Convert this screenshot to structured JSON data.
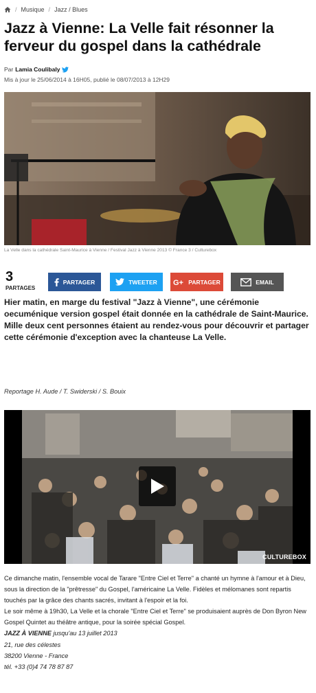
{
  "breadcrumb": {
    "home_icon": "home-icon",
    "items": [
      "Musique",
      "Jazz / Blues"
    ]
  },
  "article": {
    "title": "Jazz à Vienne: La Velle fait résonner la ferveur du gospel dans la cathédrale",
    "by_label": "Par",
    "author": "Lamia Coulibaly",
    "author_icon": "twitter-icon",
    "dates": "Mis à jour le 25/06/2014 à 16H05, publié le 08/07/2013 à 12H29",
    "image_caption": "La Velle dans la cathédrale Saint-Maurice à Vienne / Festival Jazz à Vienne 2013 © France 3 / Culturebox",
    "lead": "Hier matin, en marge du festival \"Jazz à Vienne\", une cérémonie oecuménique version gospel était donnée en la cathédrale de Saint-Maurice. Mille deux cent personnes étaient au rendez-vous pour découvrir et partager cette cérémonie d'exception avec la chanteuse La Velle.",
    "credits": "Reportage H. Aude / T. Swiderski / S. Bouix"
  },
  "share": {
    "count": "3",
    "count_label": "PARTAGES",
    "facebook_label": "PARTAGER",
    "twitter_label": "TWEETER",
    "googleplus_label": "PARTAGER",
    "email_label": "EMAIL",
    "colors": {
      "facebook": "#2b5797",
      "twitter": "#1da1f2",
      "googleplus": "#dc4a38",
      "email": "#555555"
    }
  },
  "video": {
    "brand": "CULTUREBOX",
    "play_icon": "play-icon"
  },
  "body": {
    "p1": "Ce dimanche matin, l'ensemble vocal de Tarare \"Entre Ciel et Terre\" a chanté un hymne à l'amour et à Dieu, sous la direction de la \"prêtresse\" du Gospel, l'américaine La Velle. Fidèles et mélomanes sont repartis touchés par la grâce des chants sacrés, invitant à l'espoir et la foi.",
    "p2": "Le soir même à 19h30, La Velle et la chorale \"Entre Ciel et Terre\" se produisaient auprès de Don Byron New Gospel Quintet au théâtre antique, pour la soirée spécial Gospel.",
    "event_name": "JAZZ À VIENNE",
    "event_dates": " jusqu'au 13 juillet 2013",
    "address1": "21, rue des célestes",
    "address2": "38200 Vienne - France",
    "phone": "tél. +33 (0)4 74 78 87 87"
  }
}
